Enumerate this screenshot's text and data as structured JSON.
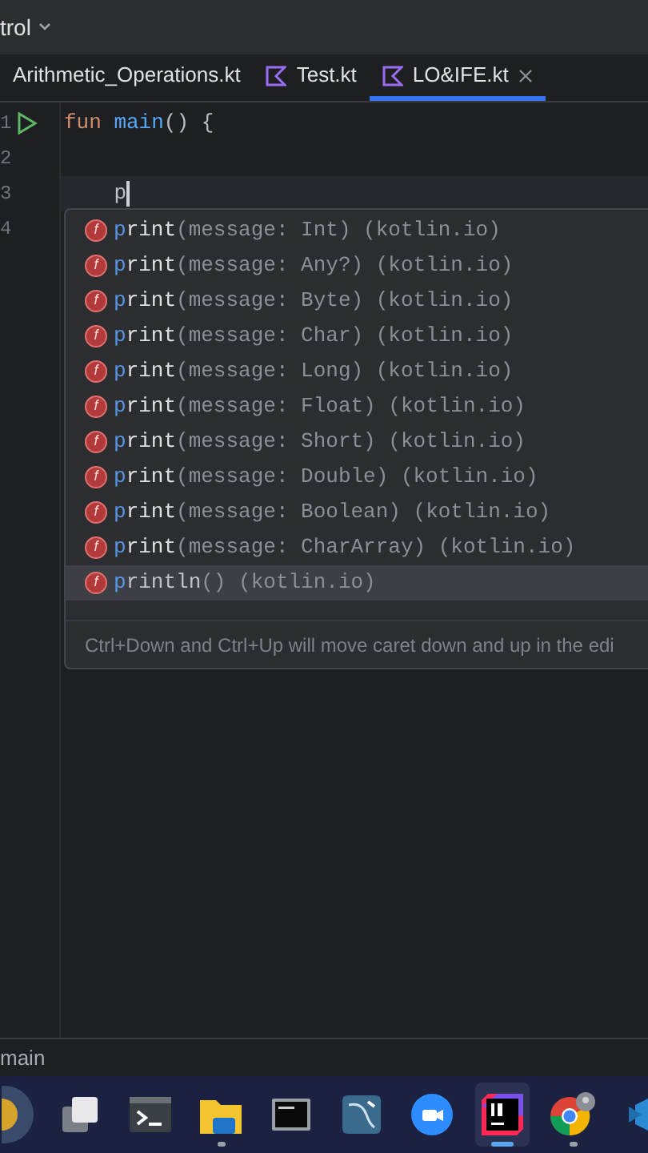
{
  "header": {
    "title": "trol"
  },
  "tabs": [
    {
      "label": "Arithmetic_Operations.kt",
      "selected": false,
      "icon": false,
      "closable": false
    },
    {
      "label": "Test.kt",
      "selected": false,
      "icon": true,
      "closable": false
    },
    {
      "label": "LO&IFE.kt",
      "selected": true,
      "icon": true,
      "closable": true
    }
  ],
  "editor": {
    "lines": [
      {
        "number": "1",
        "run": true,
        "current": false,
        "tokens": [
          {
            "kind": "keyword",
            "text": "fun"
          },
          {
            "kind": "function",
            "text": " main"
          },
          {
            "kind": "plain",
            "text": "() {"
          }
        ]
      },
      {
        "number": "2",
        "run": false,
        "current": false
      },
      {
        "number": "3",
        "run": false,
        "current": true,
        "tokens": [
          {
            "kind": "plain",
            "text": "    p"
          }
        ]
      },
      {
        "number": "4",
        "run": false,
        "current": false
      }
    ]
  },
  "completion": {
    "items": [
      {
        "icon": "f",
        "match": "p",
        "rest": "rint",
        "params": "(message: Int)",
        "package": "(kotlin.io)",
        "selected": false
      },
      {
        "icon": "f",
        "match": "p",
        "rest": "rint",
        "params": "(message: Any?)",
        "package": "(kotlin.io)",
        "selected": false
      },
      {
        "icon": "f",
        "match": "p",
        "rest": "rint",
        "params": "(message: Byte)",
        "package": "(kotlin.io)",
        "selected": false
      },
      {
        "icon": "f",
        "match": "p",
        "rest": "rint",
        "params": "(message: Char)",
        "package": "(kotlin.io)",
        "selected": false
      },
      {
        "icon": "f",
        "match": "p",
        "rest": "rint",
        "params": "(message: Long)",
        "package": "(kotlin.io)",
        "selected": false
      },
      {
        "icon": "f",
        "match": "p",
        "rest": "rint",
        "params": "(message: Float)",
        "package": "(kotlin.io)",
        "selected": false
      },
      {
        "icon": "f",
        "match": "p",
        "rest": "rint",
        "params": "(message: Short)",
        "package": "(kotlin.io)",
        "selected": false
      },
      {
        "icon": "f",
        "match": "p",
        "rest": "rint",
        "params": "(message: Double)",
        "package": "(kotlin.io)",
        "selected": false
      },
      {
        "icon": "f",
        "match": "p",
        "rest": "rint",
        "params": "(message: Boolean)",
        "package": "(kotlin.io)",
        "selected": false
      },
      {
        "icon": "f",
        "match": "p",
        "rest": "rint",
        "params": "(message: CharArray)",
        "package": "(kotlin.io)",
        "selected": false
      },
      {
        "icon": "f",
        "match": "p",
        "rest": "rintln",
        "params": "()",
        "package": "(kotlin.io)",
        "selected": true
      }
    ],
    "hint": "Ctrl+Down and Ctrl+Up will move caret down and up in the edi"
  },
  "breadcrumb": {
    "label": "main"
  },
  "taskbar": {
    "items": [
      {
        "kind": "game",
        "running": false,
        "selected": false
      },
      {
        "kind": "taskview",
        "running": false,
        "selected": false
      },
      {
        "kind": "terminal",
        "running": false,
        "selected": false
      },
      {
        "kind": "folder",
        "running": true,
        "selected": false
      },
      {
        "kind": "console",
        "running": false,
        "selected": false
      },
      {
        "kind": "database",
        "running": false,
        "selected": false
      },
      {
        "kind": "video",
        "running": false,
        "selected": false
      },
      {
        "kind": "ide",
        "running": true,
        "selected": true
      },
      {
        "kind": "browser",
        "running": true,
        "selected": false
      },
      {
        "kind": "editor",
        "running": false,
        "selected": false
      }
    ]
  }
}
